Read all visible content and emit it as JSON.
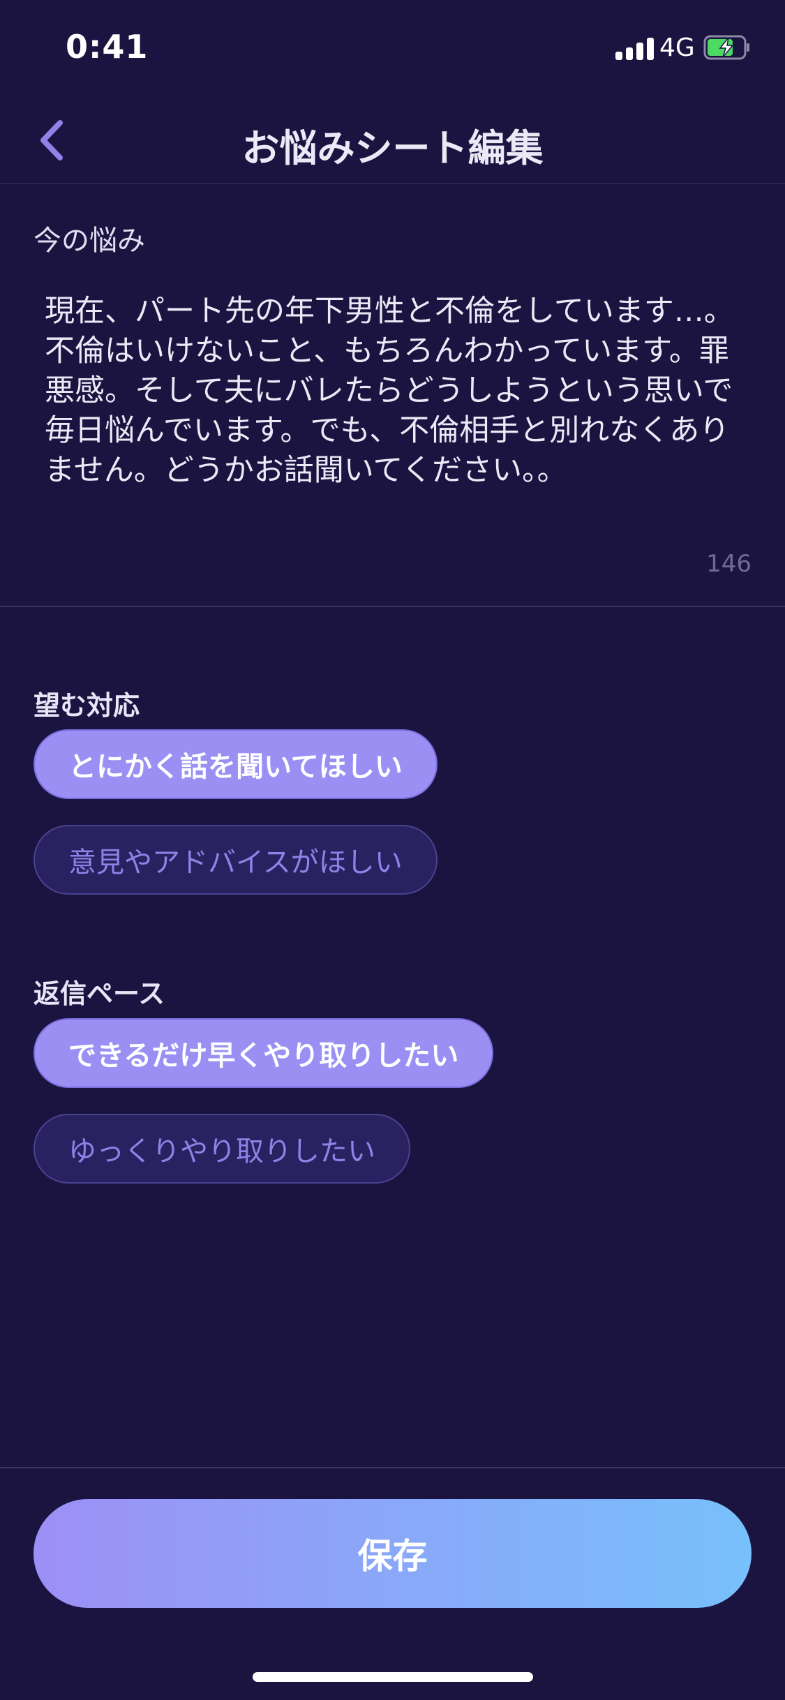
{
  "status_bar": {
    "time": "0:41",
    "network": "4G"
  },
  "nav": {
    "title": "お悩みシート編集",
    "back_icon": "chevron-left-icon"
  },
  "worry": {
    "label": "今の悩み",
    "text": "現在、パート先の年下男性と不倫をしています…。不倫はいけないこと、もちろんわかっています。罪悪感。そして夫にバレたらどうしようという思いで毎日悩んでいます。でも、不倫相手と別れなくありません。どうかお話聞いてください。。",
    "char_count": "146"
  },
  "desired_response": {
    "label": "望む対応",
    "options": [
      {
        "label": "とにかく話を聞いてほしい",
        "selected": true
      },
      {
        "label": "意見やアドバイスがほしい",
        "selected": false
      }
    ]
  },
  "reply_pace": {
    "label": "返信ペース",
    "options": [
      {
        "label": "できるだけ早くやり取りしたい",
        "selected": true
      },
      {
        "label": "ゆっくりやり取りしたい",
        "selected": false
      }
    ]
  },
  "save_button": {
    "label": "保存"
  },
  "colors": {
    "background": "#1b1440",
    "accent": "#9b8ff3",
    "pill_unselected": "#2a2260",
    "gradient_start": "#9d8ff6",
    "gradient_end": "#77c0fb"
  }
}
